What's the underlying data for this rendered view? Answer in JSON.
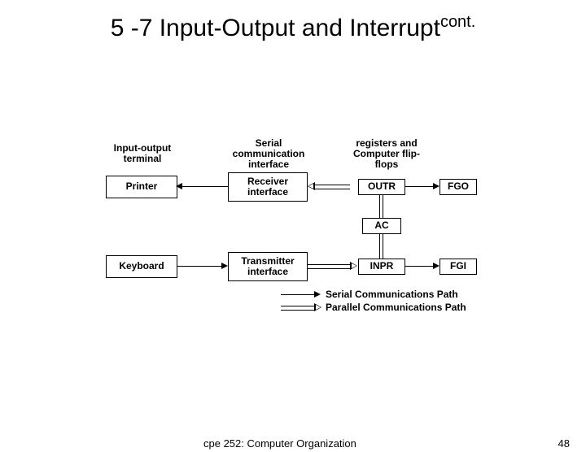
{
  "title": {
    "main": "5 -7 Input-Output and Interrupt",
    "sup": "cont."
  },
  "columns": {
    "c1": "Input-output terminal",
    "c2": "Serial communication interface",
    "c3": "registers and Computer flip-flops"
  },
  "boxes": {
    "printer": "Printer",
    "receiver": "Receiver interface",
    "outr": "OUTR",
    "fgo": "FGO",
    "ac": "AC",
    "keyboard": "Keyboard",
    "transmitter": "Transmitter interface",
    "inpr": "INPR",
    "fgi": "FGI"
  },
  "legend": {
    "serial": "Serial Communications Path",
    "parallel": "Parallel Communications Path"
  },
  "footer": {
    "course": "cpe 252: Computer Organization",
    "page": "48"
  }
}
